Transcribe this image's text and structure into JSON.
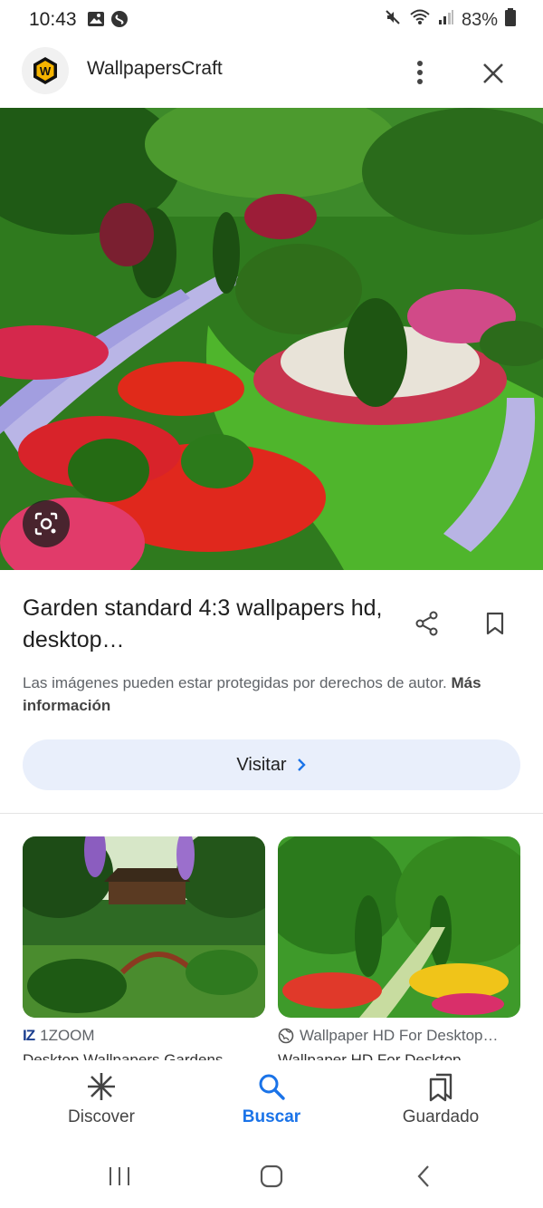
{
  "status_bar": {
    "time": "10:43",
    "battery": "83%",
    "icons": [
      "gallery-icon",
      "shazam-icon",
      "mute-icon",
      "wifi-icon",
      "signal-icon",
      "battery-icon"
    ]
  },
  "app_bar": {
    "site_name": "WallpapersCraft",
    "logo_letter": "W"
  },
  "hero": {
    "lens_icon": "lens-icon"
  },
  "result": {
    "title": "Garden standard 4:3 wallpapers hd, desktop…",
    "copyright_text": "Las imágenes pueden estar protegidas por derechos de autor.",
    "more_info": "Más información",
    "visit_label": "Visitar"
  },
  "related": [
    {
      "source": "1ZOOM",
      "caption_cut": "Desktop Wallpapers Gardens..."
    },
    {
      "source": "Wallpaper HD For Desktop…",
      "caption_cut": "Wallpaper HD For Desktop..."
    }
  ],
  "bottom_nav": [
    {
      "label": "Discover",
      "icon": "asterisk-icon",
      "active": false
    },
    {
      "label": "Buscar",
      "icon": "search-icon",
      "active": true
    },
    {
      "label": "Guardado",
      "icon": "saved-icon",
      "active": false
    }
  ],
  "colors": {
    "accent": "#1a73e8",
    "visit_bg": "#e9effb",
    "logo_yellow": "#f5b400"
  }
}
